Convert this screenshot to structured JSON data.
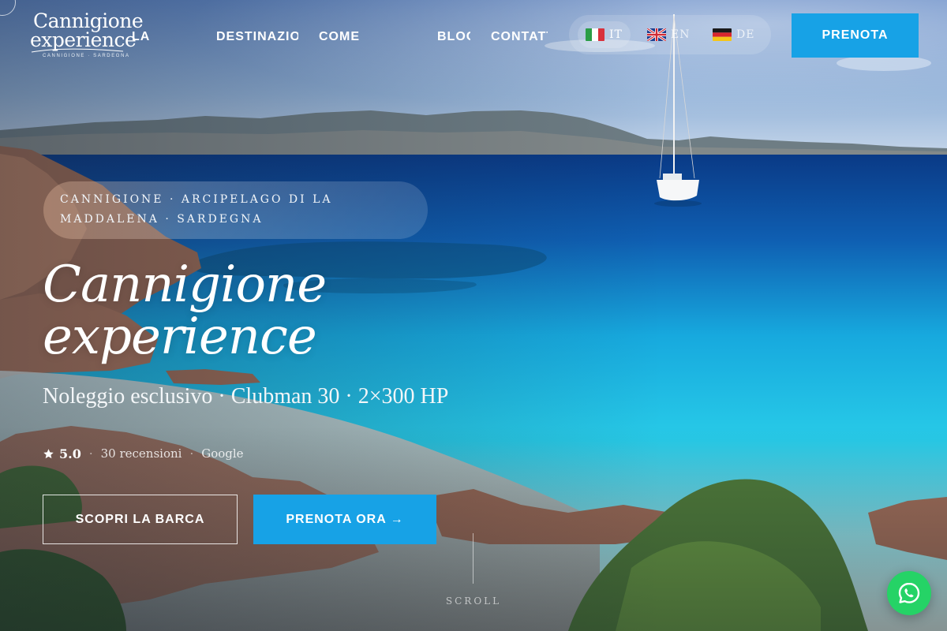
{
  "brand": {
    "logo_line1": "Cannigione",
    "logo_line2": "experience",
    "logo_sub": "CANNIGIONE · SARDEGNA"
  },
  "nav": {
    "items": [
      {
        "label": "LA"
      },
      {
        "label": "DESTINAZIO"
      },
      {
        "label": "COME"
      },
      {
        "label": "BLOG"
      },
      {
        "label": "CONTATTI"
      }
    ]
  },
  "languages": [
    {
      "code": "IT",
      "icon": "flag-it-icon",
      "active": true
    },
    {
      "code": "EN",
      "icon": "flag-uk-icon",
      "active": false
    },
    {
      "code": "DE",
      "icon": "flag-de-icon",
      "active": false
    }
  ],
  "header_cta": {
    "label": "PRENOTA"
  },
  "hero": {
    "location": "CANNIGIONE · ARCIPELAGO DI LA MADDALENA · SARDEGNA",
    "title_line1": "Cannigione",
    "title_line2": "experience",
    "subtitle": "Noleggio esclusivo · Clubman 30 · 2×300 HP",
    "rating": {
      "score": "5.0",
      "reviews": "30 recensioni",
      "source": "Google",
      "icon": "star-icon"
    },
    "cta_secondary": "SCOPRI LA BARCA",
    "cta_primary": "PRENOTA ORA →",
    "scroll_label": "SCROLL"
  },
  "floating": {
    "icon": "whatsapp-icon"
  },
  "colors": {
    "accent": "#17a2e6",
    "whatsapp": "#25d366",
    "sea_turquoise": "#19c3e6",
    "sea_deep": "#0a3f8a"
  }
}
